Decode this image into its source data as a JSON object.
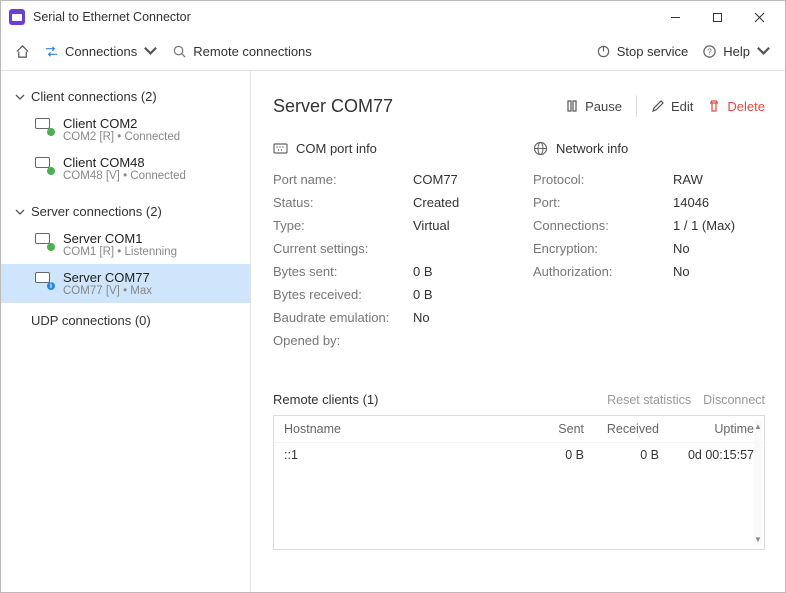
{
  "app": {
    "title": "Serial to Ethernet Connector"
  },
  "window_controls": {
    "min": "—",
    "max": "□",
    "close": "✕"
  },
  "toolbar": {
    "home": "home",
    "connections": "Connections",
    "remote_conn": "Remote connections",
    "stop_service": "Stop service",
    "help": "Help"
  },
  "sidebar": {
    "client_header": "Client connections (2)",
    "clients": [
      {
        "name": "Client COM2",
        "sub": "COM2 [R] • Connected"
      },
      {
        "name": "Client COM48",
        "sub": "COM48 [V] • Connected"
      }
    ],
    "server_header": "Server connections (2)",
    "servers": [
      {
        "name": "Server COM1",
        "sub": "COM1 [R] • Listenning"
      },
      {
        "name": "Server COM77",
        "sub": "COM77 [V] • Max",
        "selected": true
      }
    ],
    "udp": "UDP connections (0)"
  },
  "main": {
    "title": "Server COM77",
    "actions": {
      "pause": "Pause",
      "edit": "Edit",
      "delete": "Delete"
    },
    "com_section": "COM port info",
    "net_section": "Network info",
    "com_rows": [
      {
        "label": "Port name:",
        "val": "COM77"
      },
      {
        "label": "Status:",
        "val": "Created"
      },
      {
        "label": "Type:",
        "val": "Virtual"
      },
      {
        "label": "Current settings:",
        "val": ""
      },
      {
        "label": "Bytes sent:",
        "val": "0 B"
      },
      {
        "label": "Bytes received:",
        "val": "0 B"
      },
      {
        "label": "Baudrate emulation:",
        "val": "No"
      },
      {
        "label": "Opened by:",
        "val": ""
      }
    ],
    "net_rows": [
      {
        "label": "Protocol:",
        "val": "RAW"
      },
      {
        "label": "Port:",
        "val": "14046"
      },
      {
        "label": "Connections:",
        "val": "1 / 1 (Max)"
      },
      {
        "label": "Encryption:",
        "val": "No"
      },
      {
        "label": "Authorization:",
        "val": "No"
      }
    ],
    "remote": {
      "title": "Remote clients (1)",
      "reset": "Reset statistics",
      "disconnect": "Disconnect",
      "headers": {
        "host": "Hostname",
        "sent": "Sent",
        "recv": "Received",
        "up": "Uptime"
      },
      "rows": [
        {
          "host": "::1",
          "sent": "0 B",
          "recv": "0 B",
          "up": "0d 00:15:57"
        }
      ]
    }
  }
}
